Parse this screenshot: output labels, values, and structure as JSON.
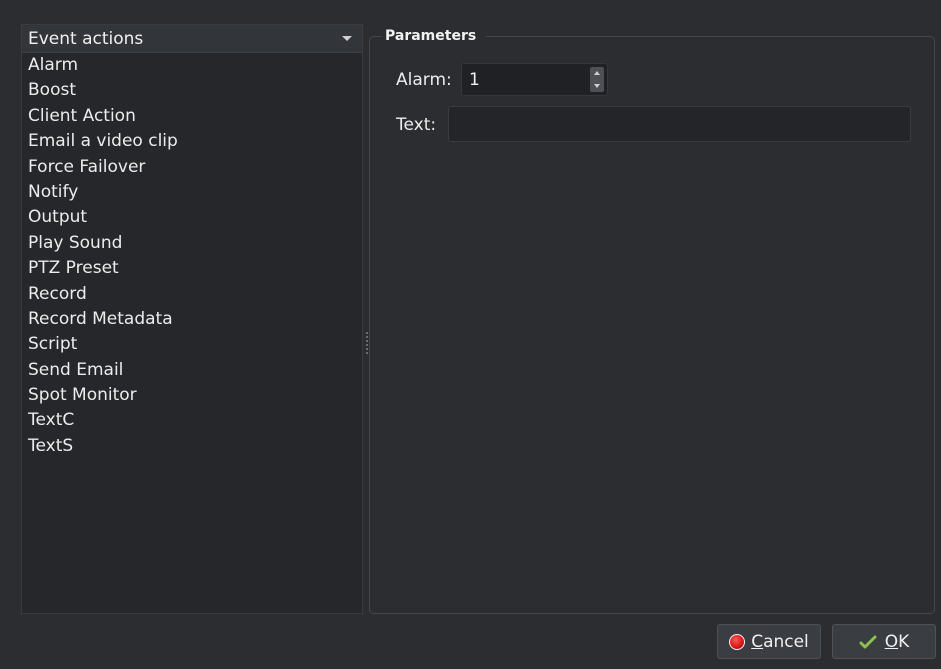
{
  "event_actions": {
    "header_label": "Event actions",
    "items": [
      "Alarm",
      "Boost",
      "Client Action",
      "Email a video clip",
      "Force Failover",
      "Notify",
      "Output",
      "Play Sound",
      "PTZ Preset",
      "Record",
      "Record Metadata",
      "Script",
      "Send Email",
      "Spot Monitor",
      "TextC",
      "TextS"
    ]
  },
  "parameters": {
    "title": "Parameters",
    "alarm_label": "Alarm:",
    "alarm_value": "1",
    "text_label": "Text:",
    "text_value": ""
  },
  "buttons": {
    "cancel_label": "Cancel",
    "ok_label": "OK"
  },
  "icons": {
    "cancel": "red-circle-icon",
    "ok": "green-check-icon",
    "dropdown": "chevron-down-icon"
  },
  "colors": {
    "background": "#2b2d31",
    "cancel_icon": "#d41414",
    "ok_icon": "#8bc34a"
  }
}
